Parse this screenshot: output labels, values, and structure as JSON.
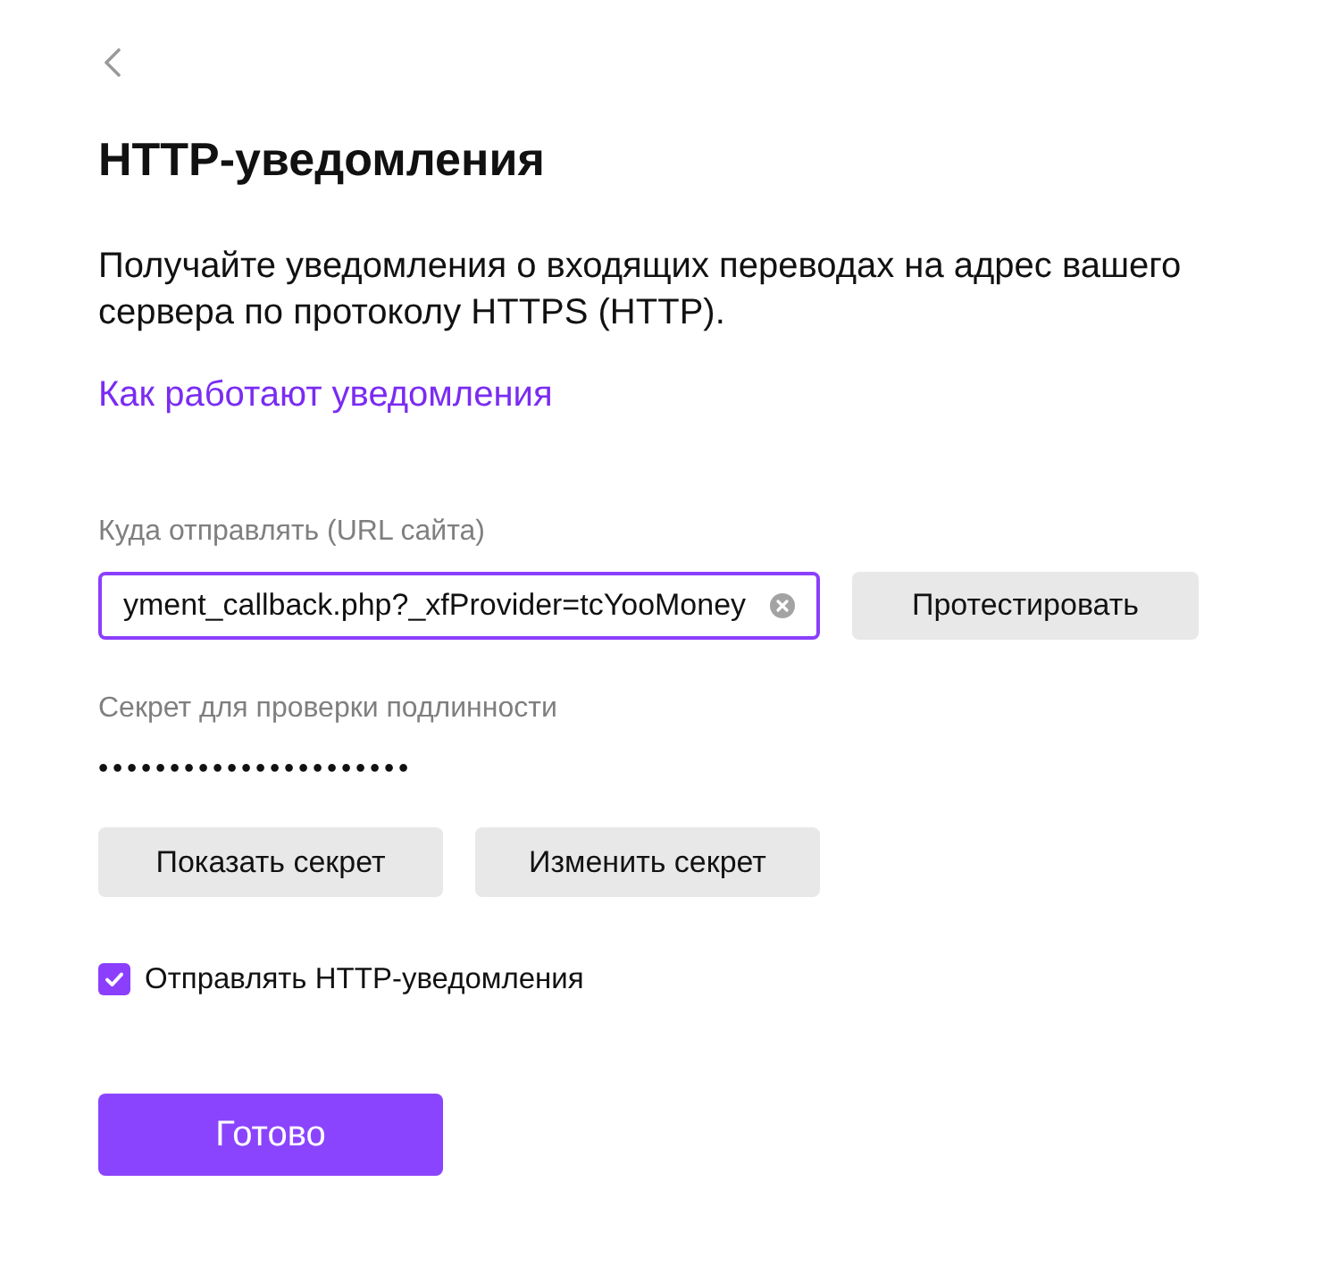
{
  "title": "HTTP-уведомления",
  "description": "Получайте уведомления о входящих переводах на адрес вашего сервера по протоколу HTTPS (HTTP).",
  "help_link": "Как работают уведомления",
  "url_field": {
    "label": "Куда отправлять (URL сайта)",
    "value": "yment_callback.php?_xfProvider=tcYooMoney",
    "focused": true
  },
  "test_button": "Протестировать",
  "secret": {
    "label": "Секрет для проверки подлинности",
    "value": "••••••••••••••••••••••"
  },
  "secret_buttons": [
    "Показать секрет",
    "Изменить секрет"
  ],
  "send_checkbox": {
    "label": "Отправлять HTTP-уведомления",
    "checked": true
  },
  "done_button": "Готово"
}
